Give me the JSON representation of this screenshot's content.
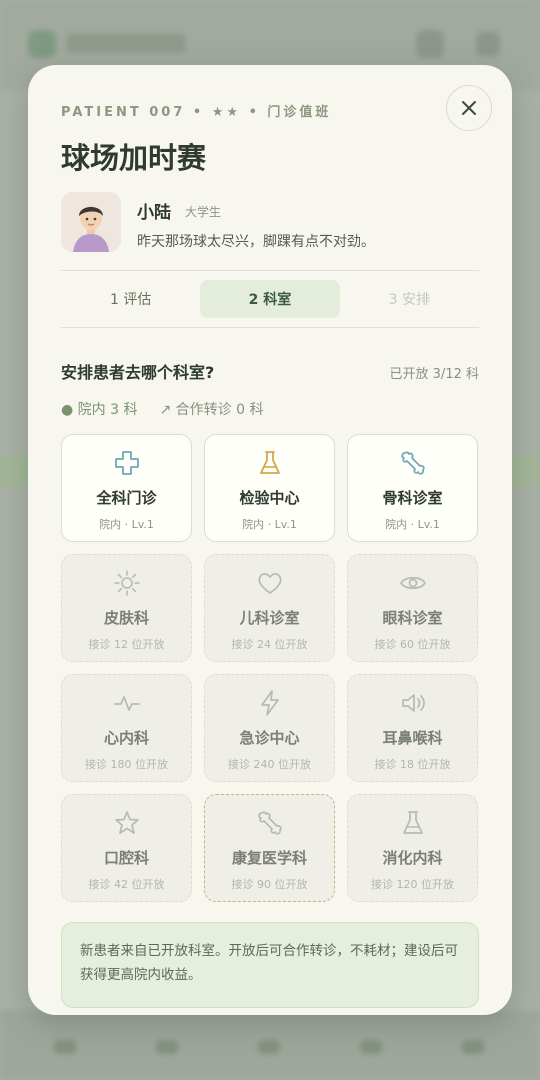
{
  "patient": {
    "eyebrow": "PATIENT 007 • ★★ • 门诊值班",
    "title": "球场加时赛",
    "name": "小陆",
    "tag": "大学生",
    "quote": "昨天那场球太尽兴，脚踝有点不对劲。"
  },
  "steps": [
    {
      "label": "1 评估"
    },
    {
      "label": "2 科室"
    },
    {
      "label": "3 安排"
    }
  ],
  "question": "安排患者去哪个科室?",
  "opened": "已开放 3/12 科",
  "stats": {
    "internal": "● 院内 3 科",
    "referral": "↗ 合作转诊 0 科"
  },
  "departments": [
    {
      "name": "全科门诊",
      "sub": "院内 · Lv.1",
      "icon": "plus-cross-icon"
    },
    {
      "name": "检验中心",
      "sub": "院内 · Lv.1",
      "icon": "flask-icon"
    },
    {
      "name": "骨科诊室",
      "sub": "院内 · Lv.1",
      "icon": "bone-icon"
    },
    {
      "name": "皮肤科",
      "sub": "接诊 12 位开放",
      "icon": "sun-icon"
    },
    {
      "name": "儿科诊室",
      "sub": "接诊 24 位开放",
      "icon": "heart-icon"
    },
    {
      "name": "眼科诊室",
      "sub": "接诊 60 位开放",
      "icon": "eye-icon"
    },
    {
      "name": "心内科",
      "sub": "接诊 180 位开放",
      "icon": "pulse-icon"
    },
    {
      "name": "急诊中心",
      "sub": "接诊 240 位开放",
      "icon": "lightning-icon"
    },
    {
      "name": "耳鼻喉科",
      "sub": "接诊 18 位开放",
      "icon": "speaker-icon"
    },
    {
      "name": "口腔科",
      "sub": "接诊 42 位开放",
      "icon": "star-icon"
    },
    {
      "name": "康复医学科",
      "sub": "接诊 90 位开放",
      "icon": "bone-icon"
    },
    {
      "name": "消化内科",
      "sub": "接诊 120 位开放",
      "icon": "flask-icon"
    }
  ],
  "notice": "新患者来自已开放科室。开放后可合作转诊，不耗材；建设后可获得更高院内收益。",
  "colors": {
    "accent_green": "#3b5a3e",
    "open_icon_teal": "#6fa7b4",
    "open_icon_gold": "#d4a64a",
    "locked_icon": "#b7bbb2"
  }
}
